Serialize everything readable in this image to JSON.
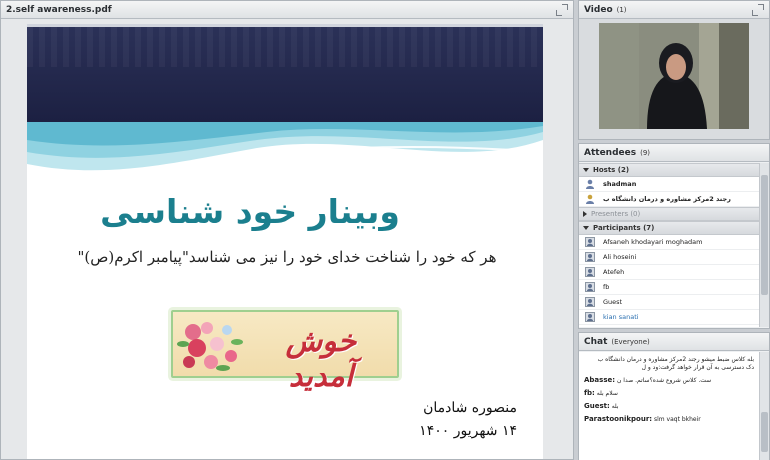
{
  "share": {
    "title": "2.self awareness.pdf",
    "slide": {
      "title": "وبینار خود شناسی",
      "subtitle": "هر که خود را شناخت خدای خود را نیز می شناسد\"پیامبر اکرم(ص)\"",
      "banner": "خوش آمدید",
      "author": "منصوره شادمان",
      "date": "۱۴ شهریور ۱۴۰۰"
    }
  },
  "video": {
    "title": "Video",
    "count": "(1)",
    "cam_label": "shadman"
  },
  "attendees": {
    "title": "Attendees",
    "count": "(9)",
    "groups": {
      "hosts": {
        "label": "Hosts (2)"
      },
      "presenters": {
        "label": "Presenters (0)"
      },
      "participants": {
        "label": "Participants (7)"
      }
    },
    "hosts": [
      "shadman",
      "ﺭﺟﻨﺪ 2ﻣﺮﮐﺰ ﻣﺸﺎﻭﺭﻩ ﻭ ﺩﺭﻣﺎﻥ ﺩﺍﻧﺸﮕﺎﻩ ﺏ"
    ],
    "participants": [
      "Afsaneh khodayari moghadam",
      "Ali hoseini",
      "Atefeh",
      "fb",
      "Guest",
      "kian sanati"
    ]
  },
  "chat": {
    "title": "Chat",
    "audience": "(Everyone)",
    "messages": [
      {
        "text1": "بله کلاس ضبط میشو ﺭﺟﻨﺪ 2ﻣﺮﮐﺰ ﻣﺸﺎﻭﺭﻩ ﻭ ﺩﺭﻣﺎﻥ ﺩﺍﻧﺸﮕﺎﻩ ﺏ",
        "text2": "دک دسترسی به آن قرار خواهد گرفت:ود و ل"
      },
      {
        "sender": "Abasse:",
        "text": "ست. کلاس شروع شده؟ساتم. صدا ن"
      },
      {
        "sender": "fb:",
        "text": "سلام بله"
      },
      {
        "sender": "Guest:",
        "text": "بله"
      },
      {
        "sender": "Parastoonikpour:",
        "text": "slm vaqt bkheir"
      }
    ]
  }
}
